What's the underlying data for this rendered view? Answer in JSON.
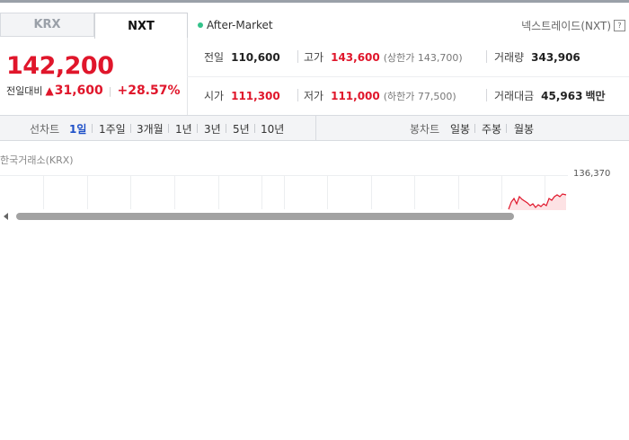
{
  "tabs": {
    "krx": "KRX",
    "nxt": "NXT"
  },
  "session": {
    "label": "After-Market",
    "status_color": "#33c28a"
  },
  "exchange_label": "넥스트레이드(NXT)",
  "help_icon": "?",
  "price": {
    "current": "142,200",
    "change_label": "전일대비",
    "direction_icon": "▲",
    "change": "31,600",
    "percent": "+28.57%"
  },
  "stats": {
    "prev_close": {
      "label": "전일",
      "value": "110,600"
    },
    "high": {
      "label": "고가",
      "value": "143,600",
      "limit_text": "(상한가 143,700)"
    },
    "volume": {
      "label": "거래량",
      "value": "343,906"
    },
    "open": {
      "label": "시가",
      "value": "111,300"
    },
    "low": {
      "label": "저가",
      "value": "111,000",
      "limit_text": "(하한가 77,500)"
    },
    "amount": {
      "label": "거래대금",
      "value": "45,963",
      "unit": "백만"
    }
  },
  "chart_nav": {
    "line_chart_label": "선차트",
    "periods": [
      "1일",
      "1주일",
      "3개월",
      "1년",
      "3년",
      "5년",
      "10년"
    ],
    "active_period": "1일",
    "candle_chart_label": "봉차트",
    "candle_periods": [
      "일봉",
      "주봉",
      "월봉"
    ]
  },
  "chart": {
    "title": "한국거래소(KRX)",
    "ref_value": "136,370",
    "line_color": "#e0162b",
    "fill_color": "#fde2e4"
  },
  "colors": {
    "up": "#e0162b",
    "active": "#1e50c8"
  }
}
